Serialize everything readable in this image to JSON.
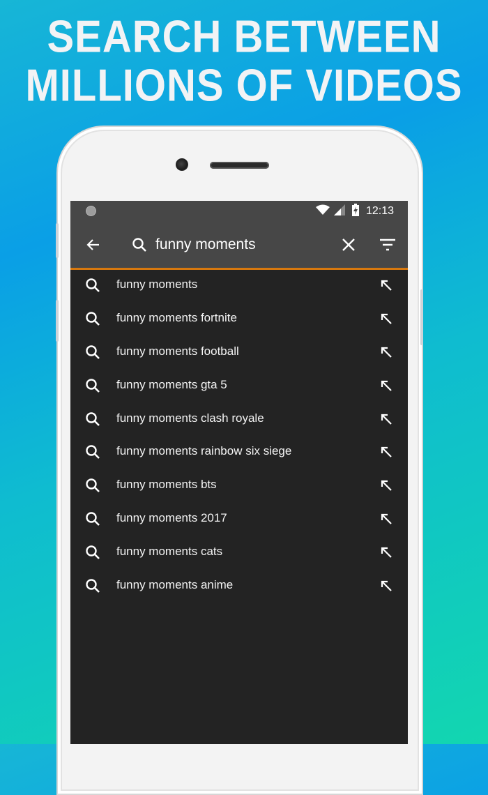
{
  "promo": {
    "line1": "SEARCH BETWEEN",
    "line2": "MILLIONS OF VIDEOS"
  },
  "colors": {
    "accent": "#d7780e",
    "toolbar_bg": "#474747",
    "screen_bg": "#232323"
  },
  "statusbar": {
    "time": "12:13",
    "icons": [
      "notification-dot-icon",
      "wifi-icon",
      "cellular-signal-icon",
      "battery-charging-icon"
    ]
  },
  "toolbar": {
    "back_icon": "arrow-back-icon",
    "search_icon": "search-icon",
    "query": "funny moments",
    "clear_icon": "close-icon",
    "filter_icon": "filter-icon"
  },
  "suggestions": [
    {
      "text": "funny moments"
    },
    {
      "text": "funny moments fortnite"
    },
    {
      "text": "funny moments football"
    },
    {
      "text": "funny moments gta 5"
    },
    {
      "text": "funny moments clash royale"
    },
    {
      "text": "funny moments rainbow six siege"
    },
    {
      "text": "funny moments bts"
    },
    {
      "text": "funny moments 2017"
    },
    {
      "text": "funny moments cats"
    },
    {
      "text": "funny moments anime"
    }
  ]
}
